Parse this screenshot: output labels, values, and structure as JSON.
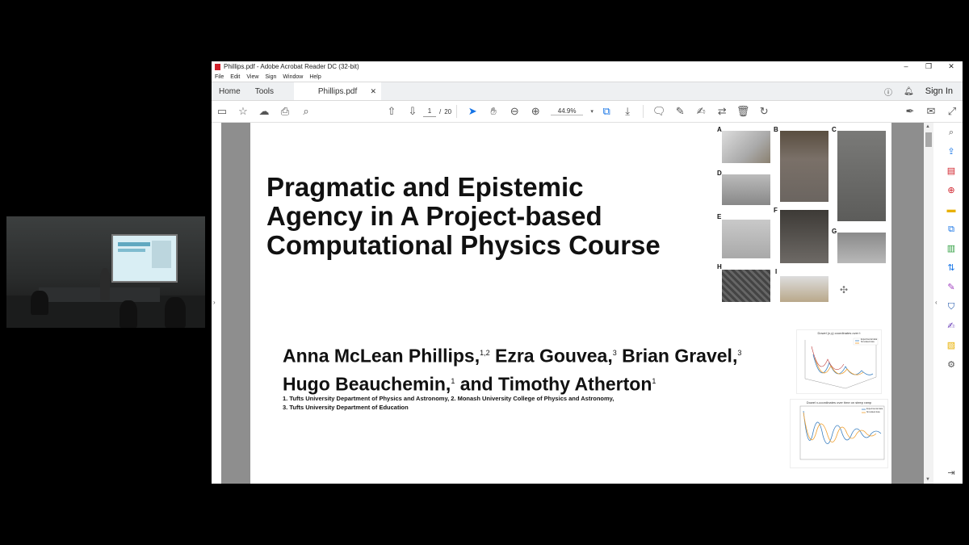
{
  "window": {
    "title": "Phillips.pdf - Adobe Acrobat Reader DC (32-bit)"
  },
  "menu": [
    "File",
    "Edit",
    "View",
    "Sign",
    "Window",
    "Help"
  ],
  "tabs": {
    "home": "Home",
    "tools": "Tools",
    "document": "Phillips.pdf",
    "sign_in": "Sign In"
  },
  "toolbar": {
    "current_page": "1",
    "page_separator": "/",
    "total_pages": "20",
    "zoom": "44.9%"
  },
  "document": {
    "title_lines": [
      "Pragmatic and Epistemic",
      "Agency in A Project-based",
      "Computational Physics Course"
    ],
    "authors_line1": [
      {
        "name": "Anna McLean Phillips,",
        "sup": "1,2"
      },
      {
        "name": " Ezra Gouvea,",
        "sup": "3"
      },
      {
        "name": " Brian Gravel,",
        "sup": "3"
      }
    ],
    "authors_line2": [
      {
        "name": "Hugo Beauchemin,",
        "sup": "1"
      },
      {
        "name": " and Timothy Atherton",
        "sup": "1"
      }
    ],
    "affiliations": [
      "1. Tufts University Department of Physics and Astronomy, 2. Monash University College of Physics and Astronomy,",
      "3. Tufts University Department of Education"
    ],
    "figure_labels": [
      "A",
      "B",
      "C",
      "D",
      "E",
      "F",
      "G",
      "H",
      "I"
    ],
    "plot1_title": "Dowel (x,y) coordinates over t",
    "plot2_title": "Dowel x-coordinates over time on steep ramp",
    "plot_legend": [
      "Experimental data",
      "Simulated data"
    ]
  },
  "colors": {
    "accent": "#1473e6",
    "pdf_red": "#d0202a",
    "series_experimental": "#3a7fc0",
    "series_simulated": "#f0a030"
  }
}
